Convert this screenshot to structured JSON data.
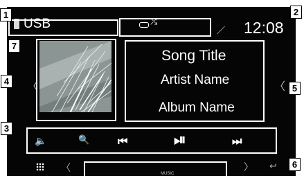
{
  "callouts": [
    "1",
    "2",
    "3",
    "4",
    "5",
    "6",
    "7"
  ],
  "header": {
    "source_label": "USB",
    "clock": "12:08"
  },
  "track": {
    "title": "Song Title",
    "artist": "Artist Name",
    "album": "Album Name"
  },
  "footer": {
    "tab_label": "MUSIC"
  },
  "icons": {
    "source": "usb-drive-icon",
    "repeat": "repeat-icon",
    "shuffle": "shuffle-icon",
    "volume": "volume-icon",
    "search": "search-icon",
    "prev": "previous-track-icon",
    "playpause": "play-pause-icon",
    "next": "next-track-icon",
    "menu": "grid-menu-icon",
    "left": "chevron-left-icon",
    "right": "chevron-right-icon",
    "back": "back-icon"
  }
}
